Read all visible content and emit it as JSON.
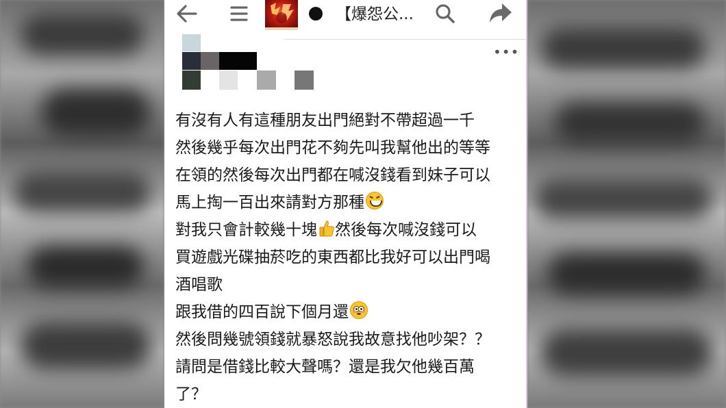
{
  "header": {
    "title": "【爆怨公...",
    "back_icon": "back-arrow-icon",
    "menu_icon": "hamburger-menu-icon",
    "search_icon": "search-icon",
    "share_icon": "share-icon",
    "more_icon": "more-options-icon",
    "more_label": "•••"
  },
  "post": {
    "lines": [
      "有沒有人有這種朋友出門絕對不帶超過一千",
      "然後幾乎每次出門花不夠先叫我幫他出的等等",
      "在領的然後每次出門都在喊沒錢看到妹子可以",
      "馬上掏一百出來請對方那種",
      "對我只會計較幾十塊",
      "然後每次喊沒錢可以",
      "買遊戲光碟抽菸吃的東西都比我好可以出門喝",
      "酒唱歌",
      "跟我借的四百說下個月還",
      "然後問幾號領錢就暴怒說我故意找他吵架？？",
      "請問是借錢比較大聲嗎？還是我欠他幾百萬",
      "了？"
    ],
    "emojis": {
      "line4": "laughing-emoji",
      "line5": "thumbs-up-emoji",
      "line9": "flushed-emoji"
    }
  },
  "colors": {
    "accent_border": "#d9c7e8",
    "icon_gray": "#666666",
    "text": "#1a1a1a"
  }
}
